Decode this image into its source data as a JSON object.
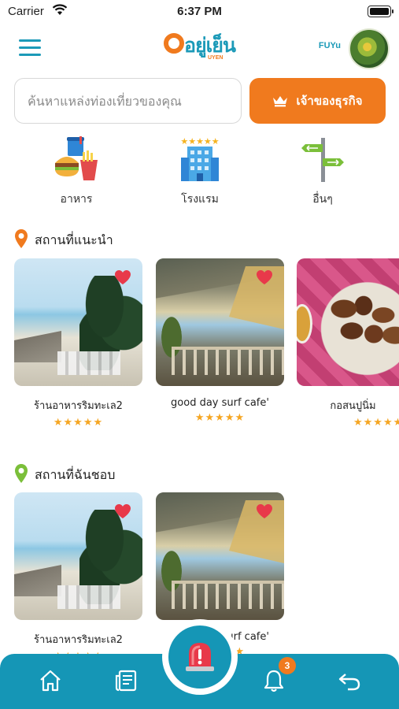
{
  "status_bar": {
    "carrier": "Carrier",
    "time": "6:37 PM"
  },
  "header": {
    "logo_text": "อยู่เย็น",
    "logo_sub": "UYEN",
    "username": "FUYu",
    "icons": [
      "menu-icon",
      "avatar"
    ]
  },
  "search": {
    "placeholder": "ค้นหาแหล่งท่องเที่ยวของคุณ",
    "value": ""
  },
  "owner_button": {
    "label": "เจ้าของธุรกิจ",
    "icon": "crown-icon"
  },
  "categories": [
    {
      "label": "อาหาร",
      "icon": "food-icon"
    },
    {
      "label": "โรงแรม",
      "icon": "hotel-icon"
    },
    {
      "label": "อื่นๆ",
      "icon": "signpost-icon"
    }
  ],
  "recommended": {
    "title": "สถานที่แนะนำ",
    "items": [
      {
        "name": "ร้านอาหารริมทะเล2",
        "stars": "★★★★★",
        "rating": 5
      },
      {
        "name": "good day surf cafe'",
        "stars": "★★★★★",
        "rating": 5
      },
      {
        "name": "กอสนปูนิ่ม",
        "stars": "★★★★★",
        "rating": 5
      }
    ]
  },
  "favorites": {
    "title": "สถานที่ฉันชอบ",
    "items": [
      {
        "name": "ร้านอาหารริมทะเล2",
        "stars": "★★★★★",
        "rating": 5
      },
      {
        "name": "good day surf cafe'",
        "stars": "★★★★★",
        "rating": 5
      }
    ]
  },
  "tabbar": {
    "notification_count": "3",
    "items": [
      "home-icon",
      "news-icon",
      "alarm-icon",
      "bell-icon",
      "back-icon"
    ]
  },
  "colors": {
    "brand_blue": "#1596b6",
    "brand_orange": "#f07a1e",
    "star": "#f5a623",
    "heart": "#e8394a"
  }
}
